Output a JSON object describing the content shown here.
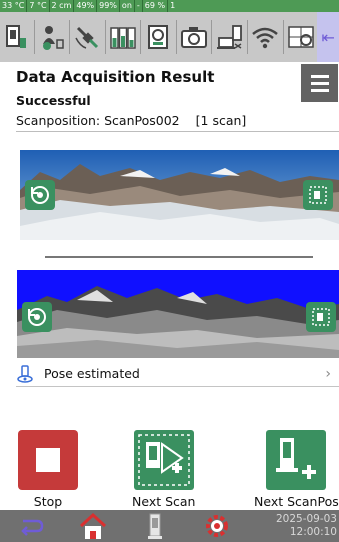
{
  "status_strip": [
    "33 °C",
    "7 °C",
    "2 cm",
    "49%",
    "99%",
    "on",
    "-",
    "69 %",
    "1"
  ],
  "toolbar": {
    "icons": [
      "scanner-battery-icon",
      "gps-person-icon",
      "satellite-icon",
      "battery-group-icon",
      "compass-icon",
      "camera-icon",
      "device-link-icon",
      "wifi-icon",
      "settings-grid-icon",
      "arrow-left-icon"
    ],
    "accent": "#6f5cd6"
  },
  "header": {
    "title": "Data Acquisition Result",
    "status": "Successful",
    "scanpos_label": "Scanposition:",
    "scanpos_value": "ScanPos002",
    "scan_count": "[1 scan]"
  },
  "panoramas": {
    "photo_name": "panorama-photo",
    "mono_name": "panorama-intensity"
  },
  "pose": {
    "label": "Pose estimated",
    "icon": "person-pin-icon"
  },
  "actions": [
    {
      "name": "stop",
      "label": "Stop",
      "color": "#c53a3a"
    },
    {
      "name": "next-scan",
      "label": "Next Scan",
      "color": "#3a9060"
    },
    {
      "name": "next-scanpos",
      "label": "Next ScanPos",
      "color": "#3a9060"
    }
  ],
  "bottom_nav": {
    "icons": [
      "back-icon",
      "home-icon",
      "scanner-icon",
      "settings-gear-icon"
    ],
    "date": "2025-09-03",
    "time": "12:00:10"
  }
}
